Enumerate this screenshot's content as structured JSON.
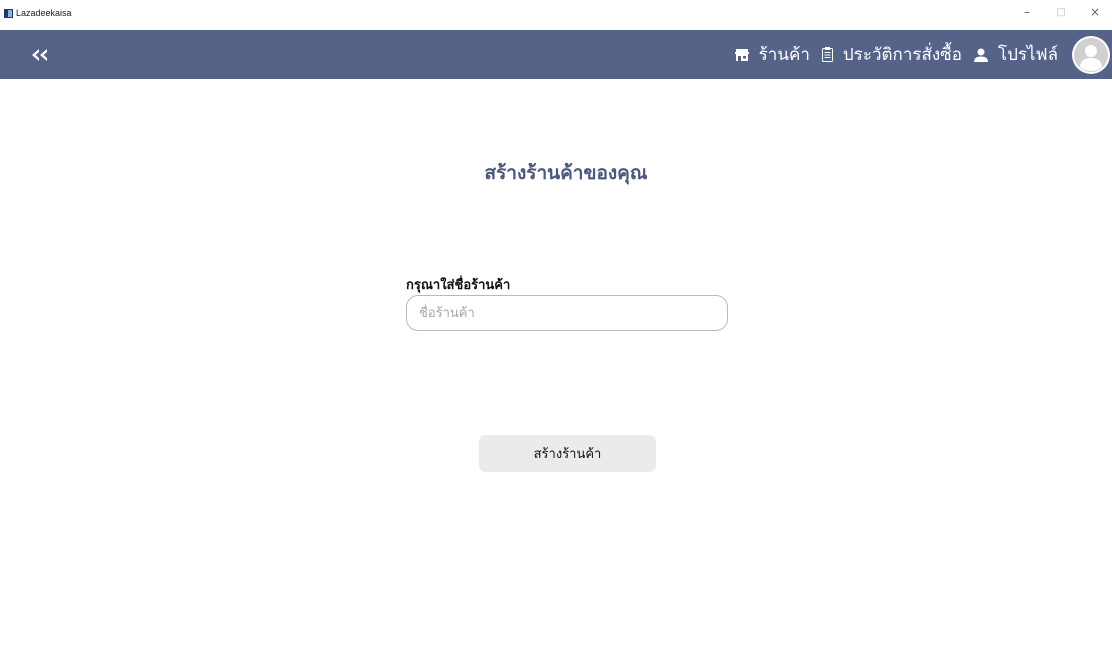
{
  "window": {
    "title": "Lazadeekaisa",
    "controls": {
      "minimize": "–",
      "maximize": "□",
      "close": "×"
    }
  },
  "navbar": {
    "background": "#566389",
    "back_icon": "double-chevron-left-icon",
    "items": [
      {
        "label": "ร้านค้า",
        "icon": "store-icon"
      },
      {
        "label": "ประวัติการสั่งซื้อ",
        "icon": "clipboard-icon"
      },
      {
        "label": "โปรไฟล์",
        "icon": "user-icon"
      }
    ],
    "avatar_icon": "avatar-icon"
  },
  "main": {
    "title": "สร้างร้านค้าของคุณ",
    "title_color": "#4b577c",
    "form": {
      "label": "กรุณาใส่ชื่อร้านค้า",
      "input_value": "",
      "input_placeholder": "ชื่อร้านค้า",
      "submit_label": "สร้างร้านค้า"
    }
  }
}
